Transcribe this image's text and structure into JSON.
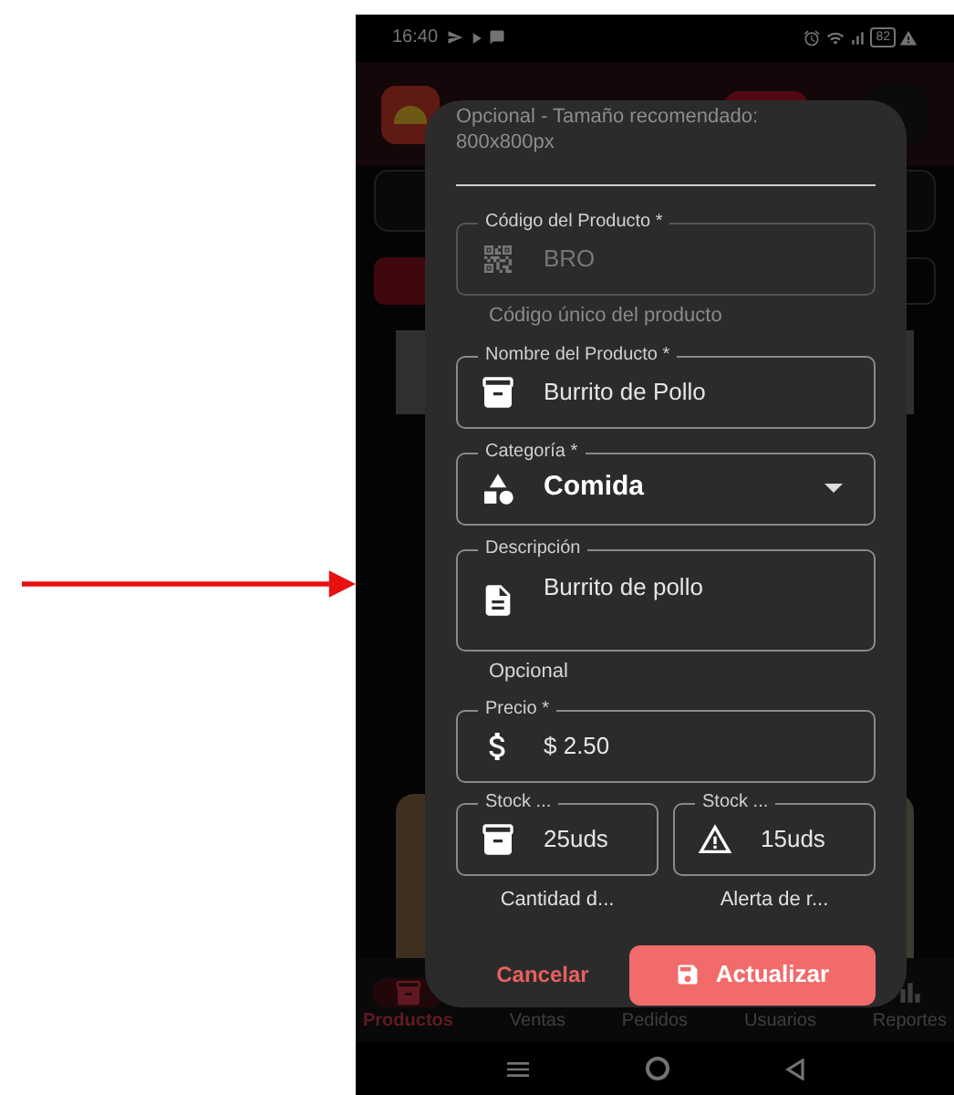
{
  "status_bar": {
    "time": "16:40",
    "battery": "82"
  },
  "dialog": {
    "image_hint": "Opcional - Tamaño recomendado: 800x800px",
    "fields": [
      {
        "label": "Código del Producto *",
        "value": "BRO",
        "kind": "text",
        "disabled": true,
        "helper": "Código único del producto"
      },
      {
        "label": "Nombre del Producto *",
        "value": "Burrito de Pollo",
        "kind": "text",
        "disabled": false
      },
      {
        "label": "Categoría *",
        "value": "Comida",
        "kind": "select",
        "disabled": false
      },
      {
        "label": "Descripción",
        "value": "Burrito de pollo",
        "kind": "multiline",
        "disabled": false,
        "helper": "Opcional"
      },
      {
        "label": "Precio *",
        "value": "$ 2.50",
        "kind": "text",
        "disabled": false
      }
    ],
    "stock_fields": [
      {
        "label": "Stock ...",
        "value": "25uds",
        "helper": "Cantidad d..."
      },
      {
        "label": "Stock ...",
        "value": "15uds",
        "helper": "Alerta de r..."
      }
    ],
    "cancel_button": "Cancelar",
    "save_button": "Actualizar"
  },
  "bottom_nav": [
    {
      "label": "Productos",
      "selected": true
    },
    {
      "label": "Ventas",
      "selected": false
    },
    {
      "label": "Pedidos",
      "selected": false
    },
    {
      "label": "Usuarios",
      "selected": false
    },
    {
      "label": "Reportes",
      "selected": false
    }
  ]
}
